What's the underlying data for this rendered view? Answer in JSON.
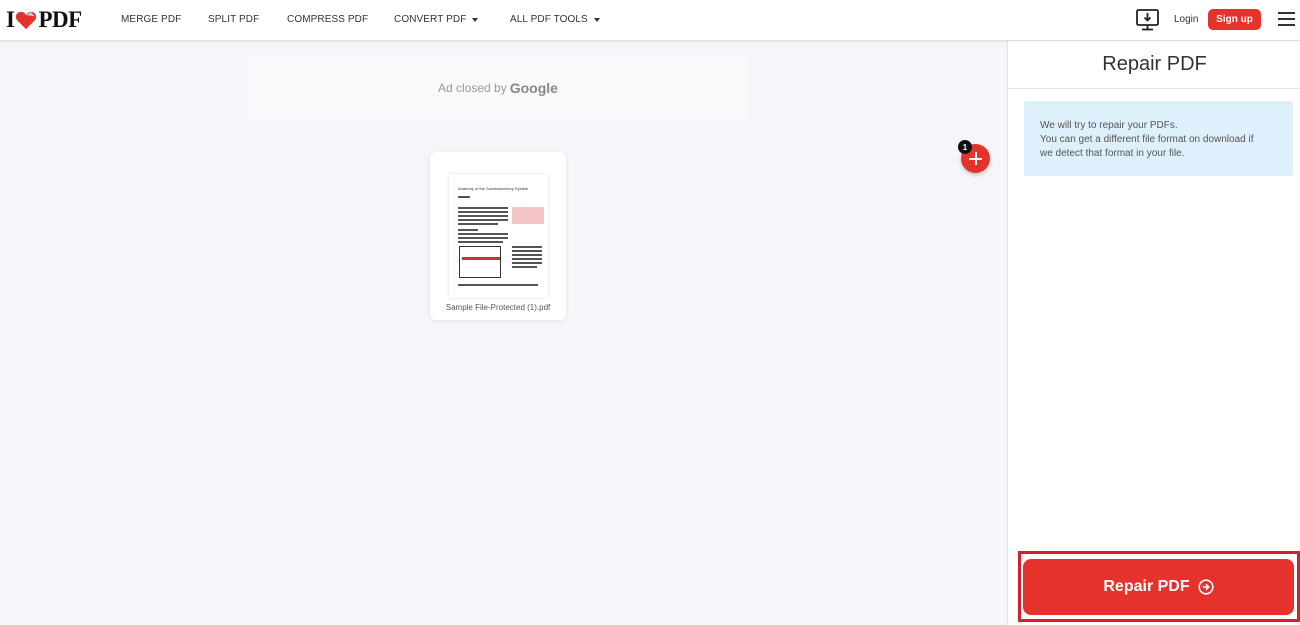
{
  "header": {
    "logo_left": "I",
    "logo_right": "PDF",
    "nav": [
      {
        "label": "MERGE PDF",
        "has_dropdown": false
      },
      {
        "label": "SPLIT PDF",
        "has_dropdown": false
      },
      {
        "label": "COMPRESS PDF",
        "has_dropdown": false
      },
      {
        "label": "CONVERT PDF",
        "has_dropdown": true
      },
      {
        "label": "ALL PDF TOOLS",
        "has_dropdown": true
      }
    ],
    "desktop_icon": "desktop-download-icon",
    "login_label": "Login",
    "signup_label": "Sign up",
    "menu_icon": "hamburger-menu-icon"
  },
  "main": {
    "ad": {
      "text": "Ad closed by",
      "brand": "Google"
    },
    "files": [
      {
        "name": "Sample File-Protected (1).pdf",
        "preview_title": "Anatomy of the Somatosensory System"
      }
    ],
    "file_count": "1",
    "add_icon": "plus-icon"
  },
  "sidebar": {
    "title": "Repair PDF",
    "info_lines": [
      "We will try to repair your PDFs.",
      "You can get a different file format on download if",
      "we detect that format in your file."
    ],
    "action_label": "Repair PDF",
    "action_icon": "arrow-right-circle-icon"
  },
  "colors": {
    "brand_red": "#e5322d",
    "info_bg": "#dff0fd",
    "highlight_outline": "#d81e2b"
  }
}
